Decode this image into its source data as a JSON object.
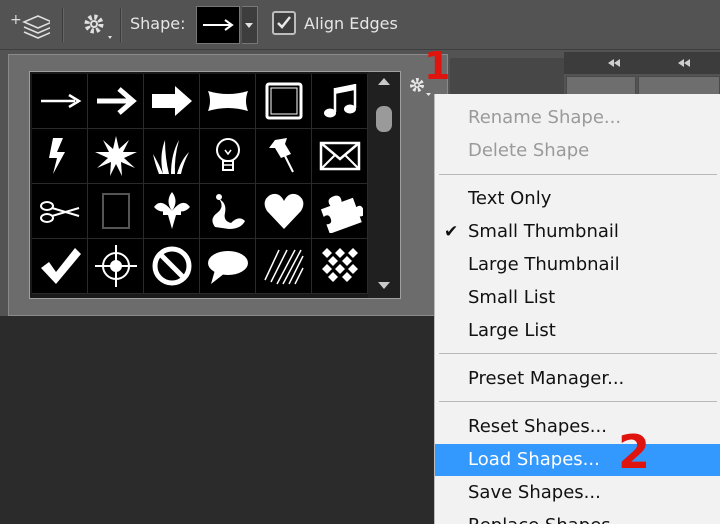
{
  "toolbar": {
    "shape_label": "Shape:",
    "align_edges_label": "Align Edges",
    "align_edges_checked": true,
    "icons": [
      "add-layer-icon",
      "gear-icon",
      "arrow-icon",
      "chevron-down-icon",
      "checkbox-icon"
    ]
  },
  "shape_picker": {
    "shapes": [
      "thin-arrow",
      "arrow",
      "thick-arrow",
      "banner",
      "frame",
      "music-note",
      "lightning",
      "starburst",
      "grass",
      "light-bulb",
      "pushpin",
      "envelope",
      "scissors",
      "frame-thin",
      "fleur-de-lis",
      "ornament",
      "heart",
      "puzzle-piece",
      "checkmark",
      "target",
      "no-sign",
      "speech-bubble",
      "hatch-pattern",
      "diamond-grid"
    ]
  },
  "callouts": {
    "first": "1",
    "second": "2"
  },
  "menu": {
    "items": [
      {
        "label": "Rename Shape...",
        "disabled": true
      },
      {
        "label": "Delete Shape",
        "disabled": true
      },
      {
        "label": "Text Only",
        "disabled": false
      },
      {
        "label": "Small Thumbnail",
        "disabled": false,
        "checked": true
      },
      {
        "label": "Large Thumbnail",
        "disabled": false
      },
      {
        "label": "Small List",
        "disabled": false
      },
      {
        "label": "Large List",
        "disabled": false
      },
      {
        "label": "Preset Manager...",
        "disabled": false
      },
      {
        "label": "Reset Shapes...",
        "disabled": false
      },
      {
        "label": "Load Shapes...",
        "disabled": false,
        "highlighted": true
      },
      {
        "label": "Save Shapes...",
        "disabled": false
      },
      {
        "label": "Replace Shapes...",
        "disabled": false
      }
    ]
  },
  "colors": {
    "highlight": "#3399ff",
    "callout": "#e0140f",
    "ui_gray": "#535353"
  }
}
